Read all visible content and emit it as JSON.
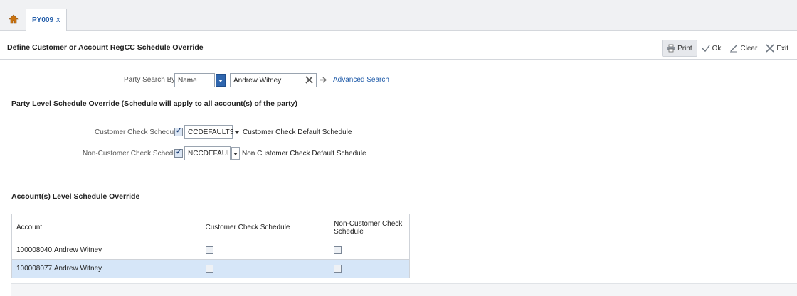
{
  "tab": {
    "label": "PY009",
    "close": "x"
  },
  "header": {
    "title": "Define Customer or Account RegCC Schedule Override"
  },
  "toolbar": {
    "print_label": "Print",
    "ok_label": "Ok",
    "clear_label": "Clear",
    "exit_label": "Exit"
  },
  "party_search": {
    "label": "Party Search By",
    "by_value": "Name",
    "name_value": "Andrew Witney",
    "advanced_link": "Advanced Search"
  },
  "party_level": {
    "title": "Party Level Schedule Override (Schedule will apply to all account(s) of the party)",
    "customer": {
      "label": "Customer Check Schedule",
      "checked": true,
      "code": "CCDEFAULTSC",
      "description": "Customer Check Default Schedule"
    },
    "non_customer": {
      "label": "Non-Customer Check Schedule",
      "checked": true,
      "code": "NCCDEFAULTS",
      "description": "Non Customer Check Default Schedule"
    }
  },
  "account_level": {
    "title": "Account(s) Level Schedule Override",
    "columns": [
      "Account",
      "Customer Check Schedule",
      "Non-Customer Check Schedule"
    ],
    "rows": [
      {
        "account": "100008040,Andrew Witney",
        "customer": false,
        "non_customer": false
      },
      {
        "account": "100008077,Andrew Witney",
        "customer": false,
        "non_customer": false
      }
    ]
  },
  "colors": {
    "accent": "#1e5aa8",
    "selected_row": "#d6e6f8"
  }
}
